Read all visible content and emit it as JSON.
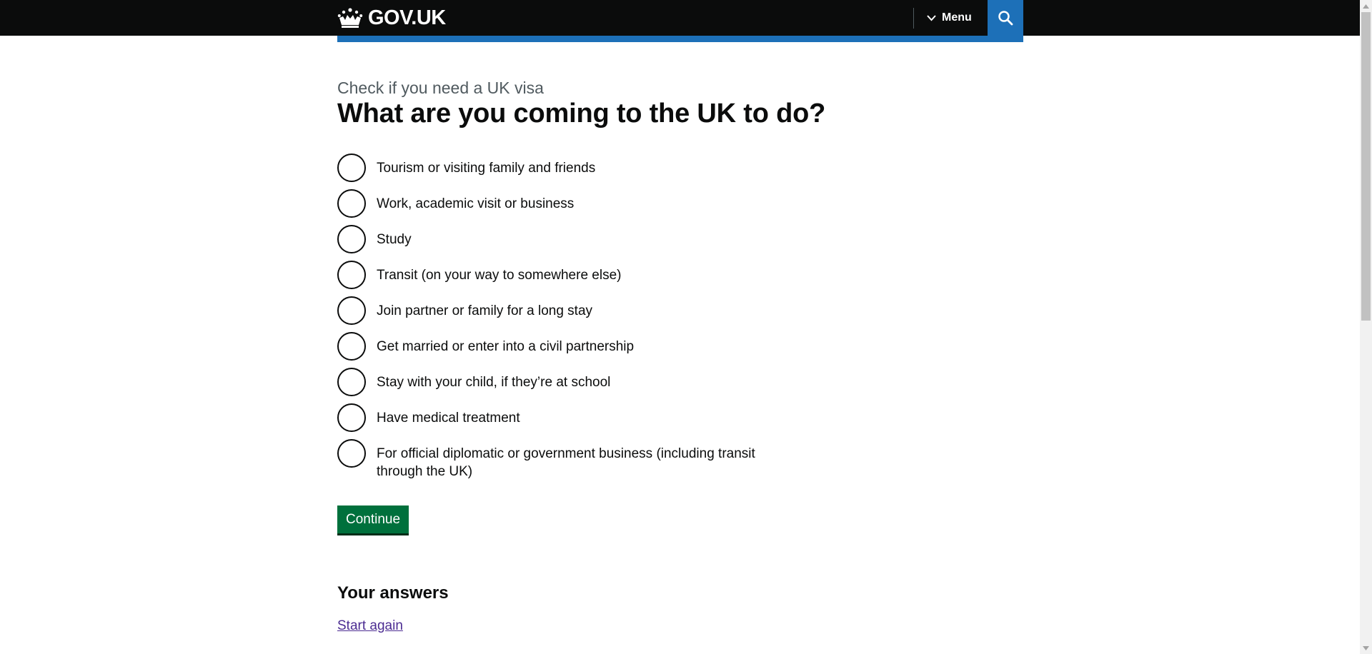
{
  "header": {
    "logo_text": "GOV.UK",
    "menu_label": "Menu",
    "search_label": "Search"
  },
  "colors": {
    "header_bg": "#0b0c0c",
    "accent_blue": "#1d70b8",
    "button_green": "#00703c",
    "link_visited": "#4c2c92"
  },
  "page": {
    "caption": "Check if you need a UK visa",
    "heading": "What are you coming to the UK to do?"
  },
  "options": [
    "Tourism or visiting family and friends",
    "Work, academic visit or business",
    "Study",
    "Transit (on your way to somewhere else)",
    "Join partner or family for a long stay",
    "Get married or enter into a civil partnership",
    "Stay with your child, if they’re at school",
    "Have medical treatment",
    "For official diplomatic or government business (including transit through the UK)"
  ],
  "continue_label": "Continue",
  "answers": {
    "heading": "Your answers",
    "start_again": "Start again"
  }
}
